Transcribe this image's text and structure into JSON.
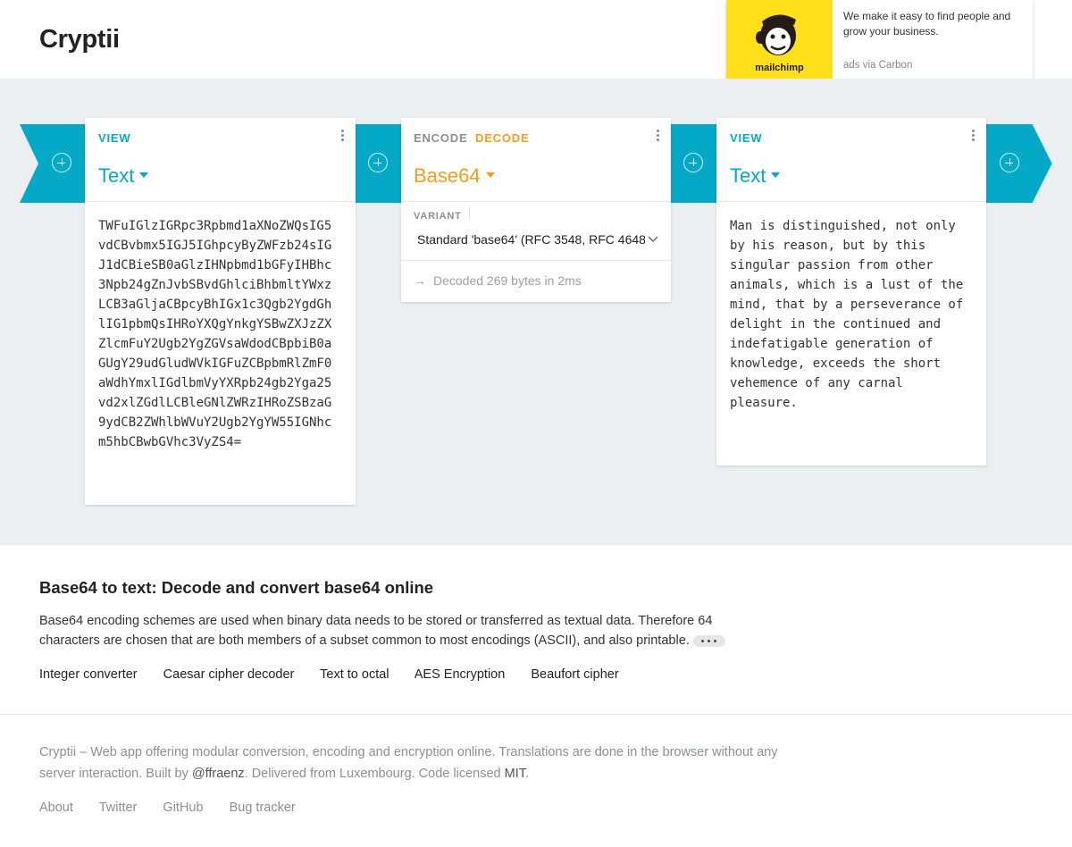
{
  "app": {
    "title": "Cryptii"
  },
  "ad": {
    "brand": "mailchimp",
    "text": "We make it easy to find people and grow your business.",
    "via": "ads via Carbon"
  },
  "bricks": [
    {
      "label": "VIEW",
      "title": "Text",
      "content": "TWFuIGlzIGRpc3Rpbmd1aXNoZWQsIG5\nvdCBvbmx5IGJ5IGhpcyByZWFzb24sIG\nJ1dCBieSB0aGlzIHNpbmd1bGFyIHBhc\n3Npb24gZnJvbSBvdGhlciBhbmltYWxz\nLCB3aGljaCBpcyBhIGx1c3Qgb2YgdGh\nlIG1pbmQsIHRoYXQgYnkgYSBwZXJzZX\nZlcmFuY2Ugb2YgZGVsaWdodCBpbiB0a\nGUgY29udGludWVkIGFuZCBpbmRlZmF0\naWdhYmxlIGdlbmVyYXRpb24gb2Yga25\nvd2xlZGdlLCBleGNlZWRzIHRoZSBzaG\n9ydCB2ZWhlbWVuY2Ugb2YgYW55IGNhc\nm5hbCBwbGVhc3VyZS4="
    },
    {
      "label_encode": "ENCODE",
      "label_decode": "DECODE",
      "title": "Base64",
      "variant_label": "VARIANT",
      "variant_value": "Standard 'base64' (RFC 3548, RFC 4648)",
      "status": "Decoded 269 bytes in 2ms"
    },
    {
      "label": "VIEW",
      "title": "Text",
      "content": "Man is distinguished, not only\nby his reason, but by this\nsingular passion from other\nanimals, which is a lust of the\nmind, that by a perseverance of\ndelight in the continued and\nindefatigable generation of\nknowledge, exceeds the short\nvehemence of any carnal\npleasure."
    }
  ],
  "article": {
    "heading": "Base64 to text: Decode and convert base64 online",
    "description": "Base64 encoding schemes are used when binary data needs to be stored or transferred as textual data. Therefore 64 characters are chosen that are both members of a subset common to most encodings (ASCII), and also printable.",
    "related": [
      "Integer converter",
      "Caesar cipher decoder",
      "Text to octal",
      "AES Encryption",
      "Beaufort cipher"
    ]
  },
  "footer": {
    "text_1": "Cryptii – Web app offering modular conversion, encoding and encryption online. Translations are done in the browser without any server interaction. Built by ",
    "author": "@ffraenz",
    "text_2": ". Delivered from Luxembourg. Code licensed ",
    "license": "MIT",
    "text_3": ".",
    "links": [
      "About",
      "Twitter",
      "GitHub",
      "Bug tracker"
    ]
  },
  "colors": {
    "accent": "#03a9c7",
    "decode": "#f59c1a",
    "workspace": "#eceff1"
  },
  "icons": [
    "plus-circle-icon",
    "more-vertical-icon",
    "caret-down-icon",
    "chevron-down-icon",
    "arrow-right-icon"
  ]
}
